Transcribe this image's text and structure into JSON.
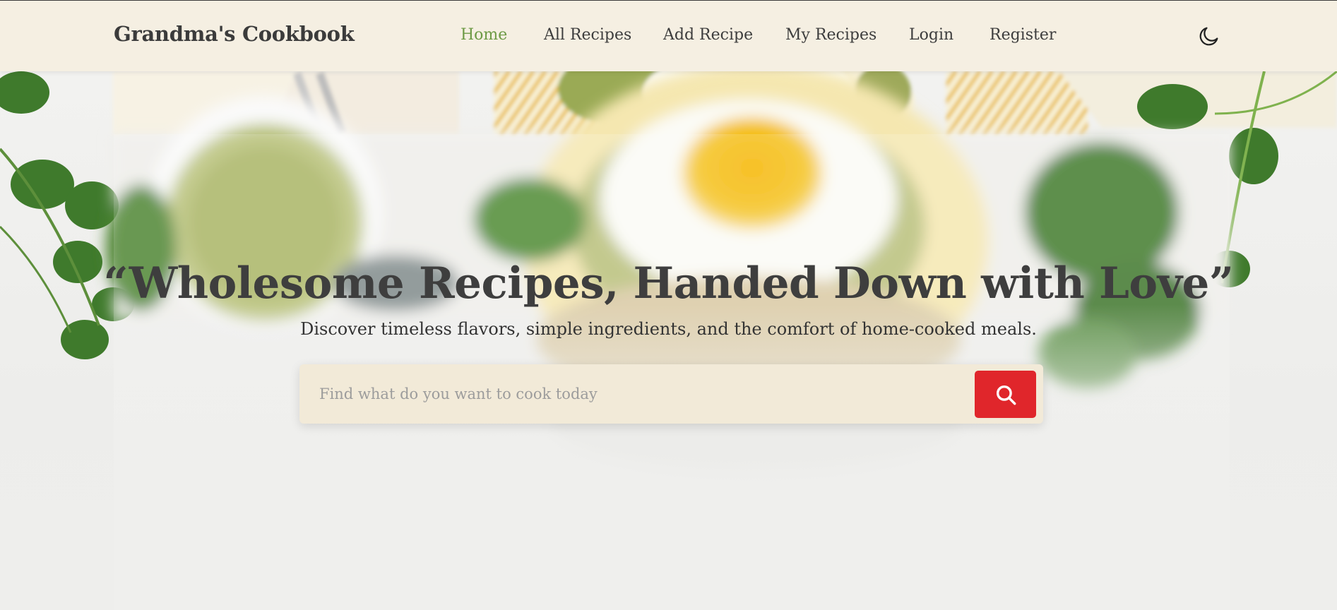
{
  "brand": "Grandma's Cookbook",
  "nav": {
    "home": "Home",
    "all_recipes": "All Recipes",
    "add_recipe": "Add Recipe",
    "my_recipes": "My Recipes",
    "login": "Login",
    "register": "Register",
    "active": "Home"
  },
  "theme_toggle_icon": "moon-icon",
  "hero": {
    "title": "“Wholesome Recipes, Handed Down with Love”",
    "subtitle": "Discover timeless flavors, simple ingredients, and the comfort of home-cooked meals.",
    "background_image": "eggs-avocado-toast-cilantro-photo"
  },
  "search": {
    "placeholder": "Find what do you want to cook today",
    "value": "",
    "button_icon": "search-icon"
  },
  "colors": {
    "navbar_bg": "#f5efe2",
    "accent_active": "#6d9a45",
    "search_button": "#e0262b",
    "search_bg": "#f2ead8",
    "text_dark": "#3e3e3e"
  }
}
